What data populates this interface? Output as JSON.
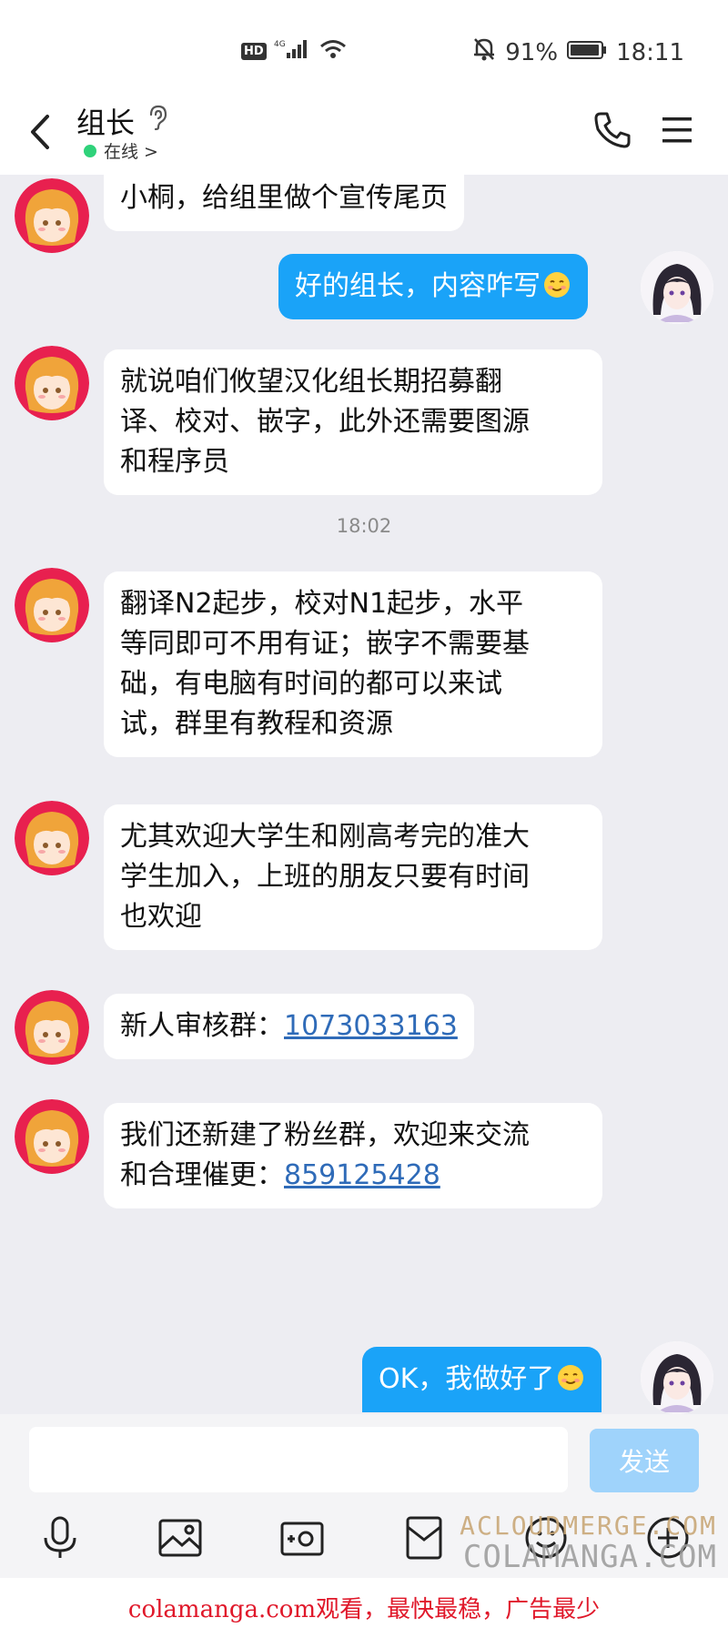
{
  "status_bar": {
    "hd": "HD",
    "network": "4G",
    "battery": "91%",
    "time": "18:11"
  },
  "header": {
    "title": "组长",
    "status": "在线 >"
  },
  "messages": [
    {
      "side": "in",
      "text": "小桐，给组里做个宣传尾页"
    },
    {
      "side": "out",
      "text": "好的组长，内容咋写"
    },
    {
      "side": "in",
      "lines": [
        "就说咱们攸望汉化组长期招募翻",
        "译、校对、嵌字，此外还需要图源",
        "和程序员"
      ]
    },
    {
      "timestamp": "18:02"
    },
    {
      "side": "in",
      "lines": [
        "翻译N2起步，校对N1起步，水平",
        "等同即可不用有证；嵌字不需要基",
        "础，有电脑有时间的都可以来试",
        "试，群里有教程和资源"
      ]
    },
    {
      "side": "in",
      "lines": [
        "尤其欢迎大学生和刚高考完的准大",
        "学生加入，上班的朋友只要有时间",
        "也欢迎"
      ]
    },
    {
      "side": "in",
      "prefix": "新人审核群：",
      "link": "1073033163"
    },
    {
      "side": "in",
      "line1": "我们还新建了粉丝群，欢迎来交流",
      "prefix": "和合理催更：",
      "link": "859125428"
    },
    {
      "side": "out",
      "text": "OK，我做好了"
    }
  ],
  "input": {
    "send_label": "发送"
  },
  "watermark": {
    "line1": "ACLOUDMERGE.COM",
    "line2": "COLAMANGA.COM"
  },
  "footer": {
    "text": "colamanga.com观看，最快最稳，广告最少"
  },
  "colors": {
    "outgoing_bubble": "#1aa3f8",
    "incoming_bubble": "#ffffff",
    "send_button": "#9fd3fb",
    "online_dot": "#2fd27a",
    "link": "#2f6bb8",
    "footer_text": "#e0182a"
  }
}
